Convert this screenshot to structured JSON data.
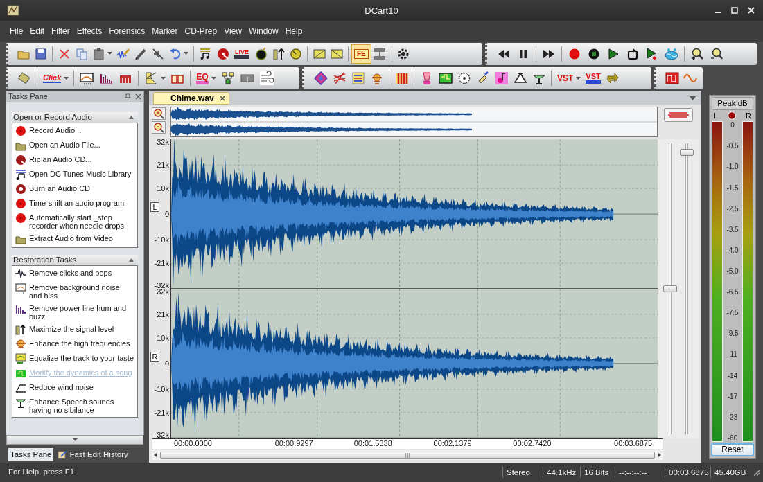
{
  "window": {
    "title": "DCart10"
  },
  "menu": [
    "File",
    "Edit",
    "Filter",
    "Effects",
    "Forensics",
    "Marker",
    "CD-Prep",
    "View",
    "Window",
    "Help"
  ],
  "toolbar_texts": [
    {
      "text": "LIVE",
      "pressed": false
    },
    {
      "text": "FE",
      "pressed": true
    },
    {
      "text": "Click",
      "pressed": false
    },
    {
      "text": "EQ",
      "pressed": false
    },
    {
      "text": "VST",
      "pressed": false
    },
    {
      "text": "VST",
      "pressed": false
    }
  ],
  "tasks_pane": {
    "title": "Tasks Pane",
    "sections": [
      {
        "title": "Open or Record Audio",
        "expanded": true,
        "items": [
          {
            "label": "Record Audio...",
            "disabled": false
          },
          {
            "label": "Open an Audio File...",
            "disabled": false
          },
          {
            "label": "Rip an Audio CD...",
            "disabled": false
          },
          {
            "label": "Open DC Tunes Music Library",
            "disabled": false
          },
          {
            "label": "Burn an Audio CD",
            "disabled": false
          },
          {
            "label": "Time-shift an audio program",
            "disabled": false
          },
          {
            "label": "Automatically start _stop recorder when needle drops",
            "disabled": false
          },
          {
            "label": "Extract Audio from Video",
            "disabled": false
          }
        ]
      },
      {
        "title": "Restoration Tasks",
        "expanded": true,
        "items": [
          {
            "label": "Remove clicks and pops",
            "disabled": false
          },
          {
            "label": "Remove background noise and hiss",
            "disabled": false
          },
          {
            "label": "Remove power line hum and buzz",
            "disabled": false
          },
          {
            "label": "Maximize the signal level",
            "disabled": false
          },
          {
            "label": "Enhance the high frequencies",
            "disabled": false
          },
          {
            "label": "Equalize the track to your taste",
            "disabled": false
          },
          {
            "label": "Modify the dynamics of a song",
            "disabled": true
          },
          {
            "label": "Reduce wind noise",
            "disabled": false
          },
          {
            "label": "Enhance Speech sounds having no sibilance",
            "disabled": false
          }
        ]
      }
    ]
  },
  "bottom_tabs": [
    {
      "label": "Tasks Pane",
      "selected": true
    },
    {
      "label": "Fast Edit History",
      "selected": false
    }
  ],
  "document_tabs": [
    {
      "label": "Chime.wav",
      "selected": true
    }
  ],
  "channels": [
    {
      "label": "L",
      "y_ticks": [
        "32k",
        "21k",
        "10k",
        "0",
        "-10k",
        "-21k",
        "-32k"
      ]
    },
    {
      "label": "R",
      "y_ticks": [
        "32k",
        "21k",
        "10k",
        "0",
        "-10k",
        "-21k",
        "-32k"
      ]
    }
  ],
  "time_ruler": [
    "00:00.0000",
    "00:00.9297",
    "00:01.5338",
    "00:02.1379",
    "00:02.7420",
    "00:03.6875"
  ],
  "vertical_sliders": [
    {
      "level": 0.5
    },
    {
      "level": 0.98
    }
  ],
  "meter": {
    "title": "Peak dB",
    "left": "L",
    "right": "R",
    "scale": [
      "0",
      "-0.5",
      "-1.0",
      "-1.5",
      "-2.5",
      "-3.5",
      "-4.0",
      "-5.0",
      "-6.5",
      "-7.5",
      "-9.5",
      "-11",
      "-14",
      "-17",
      "-23",
      "-60"
    ],
    "reset": "Reset"
  },
  "status_bar": {
    "help": "For Help, press F1",
    "cells": [
      "Stereo",
      "44.1kHz",
      "16 Bits",
      "--:--:--:--",
      "00:03.6875",
      "45.40GB"
    ]
  }
}
